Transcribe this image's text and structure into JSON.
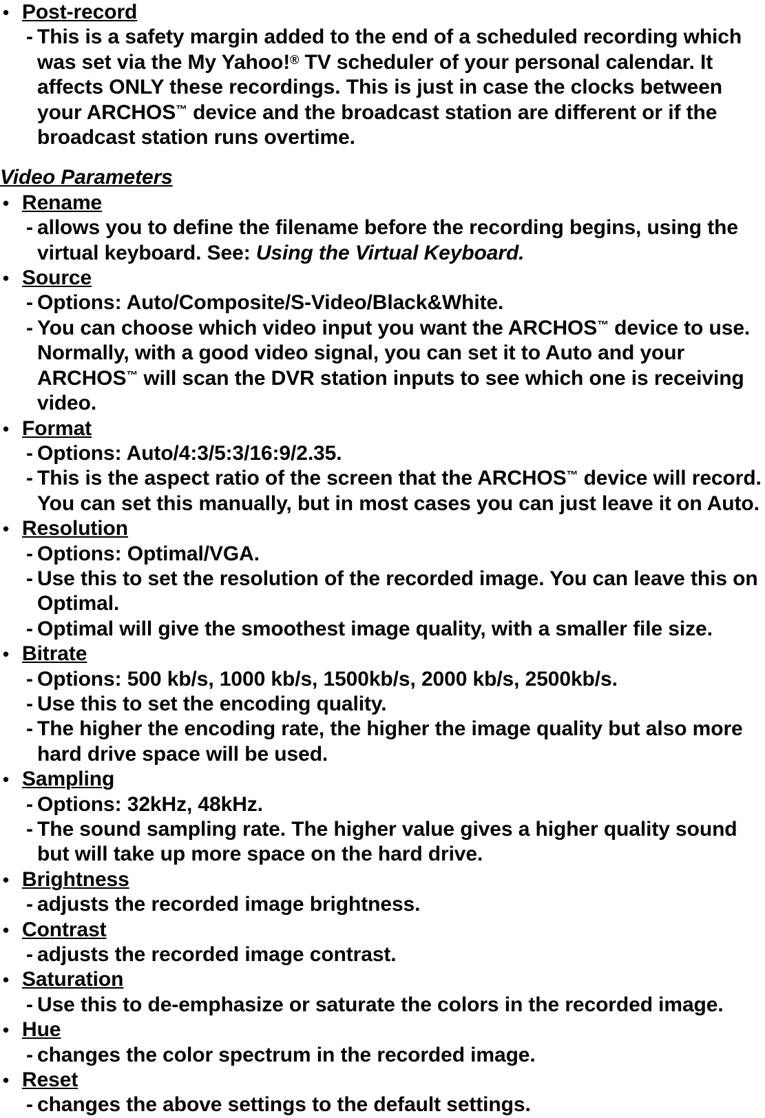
{
  "document": {
    "background_color": "#ffffff",
    "text_color": "#000000",
    "blocks": [
      {
        "kind": "bullet",
        "label": "Post-record",
        "subs": [
          "This is a safety margin added to the end of a scheduled recording which was set via the My Yahoo!® TV scheduler of your personal calendar. It affects ONLY these recordings. This is just in case the clocks between your ARCHOS™ device and the broadcast station are different or if the broadcast station runs overtime."
        ]
      },
      {
        "kind": "section",
        "label": "Video Parameters"
      },
      {
        "kind": "bullet",
        "label": "Rename",
        "subs": [
          "allows you to define the filename before the recording begins, using the virtual keyboard. See: Using the Virtual Keyboard."
        ]
      },
      {
        "kind": "bullet",
        "label": "Source",
        "subs": [
          "Options: Auto/Composite/S-Video/Black&White.",
          "You can choose which video input you want the ARCHOS™ device to use. Normally, with a good video signal, you can set it to Auto and your ARCHOS™ will scan the DVR station inputs to see which one is receiving video."
        ]
      },
      {
        "kind": "bullet",
        "label": "Format",
        "subs": [
          "Options: Auto/4:3/5:3/16:9/2.35.",
          "This is the aspect ratio of the screen that the ARCHOS™ device will record. You can set this manually, but in most cases you can just leave it on Auto."
        ]
      },
      {
        "kind": "bullet",
        "label": "Resolution",
        "subs": [
          "Options: Optimal/VGA.",
          "Use this to set the resolution of the recorded image. You can leave this on Optimal.",
          "Optimal will give the smoothest image quality, with a smaller file size."
        ]
      },
      {
        "kind": "bullet",
        "label": "Bitrate",
        "subs": [
          "Options: 500 kb/s, 1000 kb/s, 1500kb/s, 2000 kb/s, 2500kb/s.",
          "Use this to set the encoding quality.",
          "The higher the encoding rate, the higher the image quality but also more hard drive space will be used."
        ]
      },
      {
        "kind": "bullet",
        "label": "Sampling",
        "subs": [
          "Options: 32kHz, 48kHz.",
          "The sound sampling rate. The higher value gives a higher quality sound but will take up more space on the hard drive."
        ]
      },
      {
        "kind": "bullet",
        "label": "Brightness",
        "subs": [
          "adjusts the recorded image brightness."
        ]
      },
      {
        "kind": "bullet",
        "label": "Contrast",
        "subs": [
          "adjusts the recorded image contrast."
        ]
      },
      {
        "kind": "bullet",
        "label": "Saturation",
        "subs": [
          "Use this to de-emphasize or saturate the colors in the recorded image."
        ]
      },
      {
        "kind": "bullet",
        "label": "Hue",
        "subs": [
          "changes the color spectrum in the recorded image."
        ]
      },
      {
        "kind": "bullet",
        "label": "Reset",
        "subs": [
          "changes the above settings to the default settings."
        ]
      }
    ],
    "glyphs": {
      "bullet": "•",
      "dash": "-",
      "trademark": "™",
      "registered": "®"
    },
    "italic_phrases": [
      "Using the Virtual Keyboard."
    ]
  }
}
